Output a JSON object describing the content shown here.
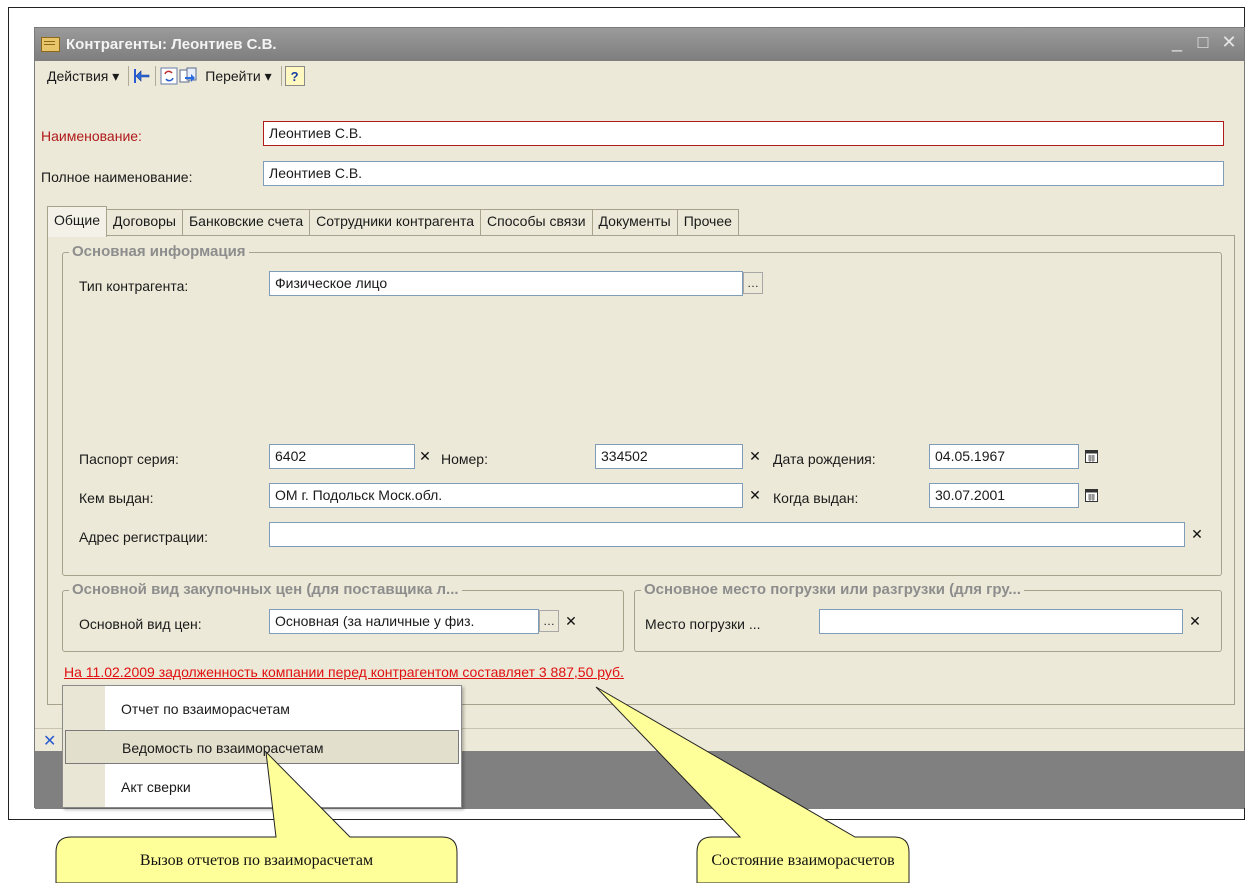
{
  "window": {
    "title": "Контрагенты: Леонтиев С.В.",
    "controls": [
      "_",
      "□",
      "✕"
    ]
  },
  "toolbar": {
    "actions_label": "Действия ▾",
    "goto_label": "Перейти ▾",
    "help_label": "?"
  },
  "header": {
    "name_label": "Наименование:",
    "name_value": "Леонтиев С.В.",
    "fullname_label": "Полное наименование:",
    "fullname_value": "Леонтиев С.В."
  },
  "tabs": [
    "Общие",
    "Договоры",
    "Банковские счета",
    "Сотрудники контрагента",
    "Способы связи",
    "Документы",
    "Прочее"
  ],
  "main_info": {
    "group_title": "Основная информация",
    "type_label": "Тип контрагента:",
    "type_value": "Физическое лицо",
    "passport_series_label": "Паспорт серия:",
    "passport_series_value": "6402",
    "number_label": "Номер:",
    "number_value": "334502",
    "birth_label": "Дата рождения:",
    "birth_value": "04.05.1967",
    "issued_by_label": "Кем выдан:",
    "issued_by_value": "ОМ г. Подольск Моск.обл.",
    "issued_when_label": "Когда выдан:",
    "issued_when_value": "30.07.2001",
    "address_label": "Адрес регистрации:",
    "address_value": ""
  },
  "price_group": {
    "title": "Основной вид закупочных цен (для поставщика л...",
    "label": "Основной вид цен:",
    "value": "Основная (за наличные у физ."
  },
  "load_group": {
    "title": "Основное место погрузки или разгрузки (для гру...",
    "label": "Место погрузки ...",
    "value": ""
  },
  "debt_link": "На 11.02.2009 задолженность компании перед контрагентом составляет 3 887,50 руб.",
  "context_menu": [
    "Отчет по взаиморасчетам",
    "Ведомость по взаиморасчетам",
    "Акт сверки"
  ],
  "callouts": {
    "reports": "Вызов отчетов по  взаиморасчетам",
    "state": "Состояние взаиморасчетов"
  },
  "colors": {
    "window_bg": "#ece9d8",
    "titlebar": "#8c8c8c",
    "required_label": "#b01a1a",
    "debt_link": "#e01010",
    "callout_fill": "#ffff99"
  }
}
